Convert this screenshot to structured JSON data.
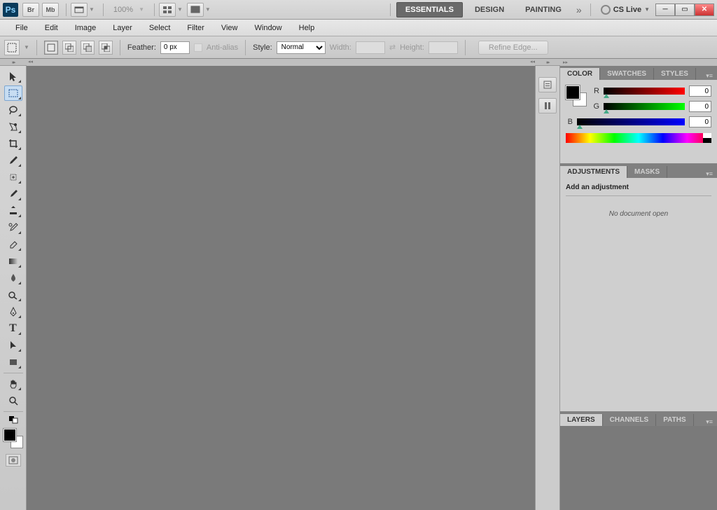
{
  "appBar": {
    "logo": "Ps",
    "brBadge": "Br",
    "mbBadge": "Mb",
    "zoom": "100%",
    "workspaces": [
      "ESSENTIALS",
      "DESIGN",
      "PAINTING"
    ],
    "activeWorkspace": 0,
    "csLive": "CS Live"
  },
  "menu": [
    "File",
    "Edit",
    "Image",
    "Layer",
    "Select",
    "Filter",
    "View",
    "Window",
    "Help"
  ],
  "options": {
    "featherLabel": "Feather:",
    "featherValue": "0 px",
    "antiAlias": "Anti-alias",
    "styleLabel": "Style:",
    "styleValue": "Normal",
    "widthLabel": "Width:",
    "widthValue": "",
    "heightLabel": "Height:",
    "heightValue": "",
    "refineEdge": "Refine Edge..."
  },
  "colorPanel": {
    "tabs": [
      "COLOR",
      "SWATCHES",
      "STYLES"
    ],
    "activeTab": 0,
    "r": {
      "label": "R",
      "value": "0"
    },
    "g": {
      "label": "G",
      "value": "0"
    },
    "b": {
      "label": "B",
      "value": "0"
    }
  },
  "adjPanel": {
    "tabs": [
      "ADJUSTMENTS",
      "MASKS"
    ],
    "activeTab": 0,
    "title": "Add an adjustment",
    "noDoc": "No document open"
  },
  "layersPanel": {
    "tabs": [
      "LAYERS",
      "CHANNELS",
      "PATHS"
    ],
    "activeTab": 0
  }
}
